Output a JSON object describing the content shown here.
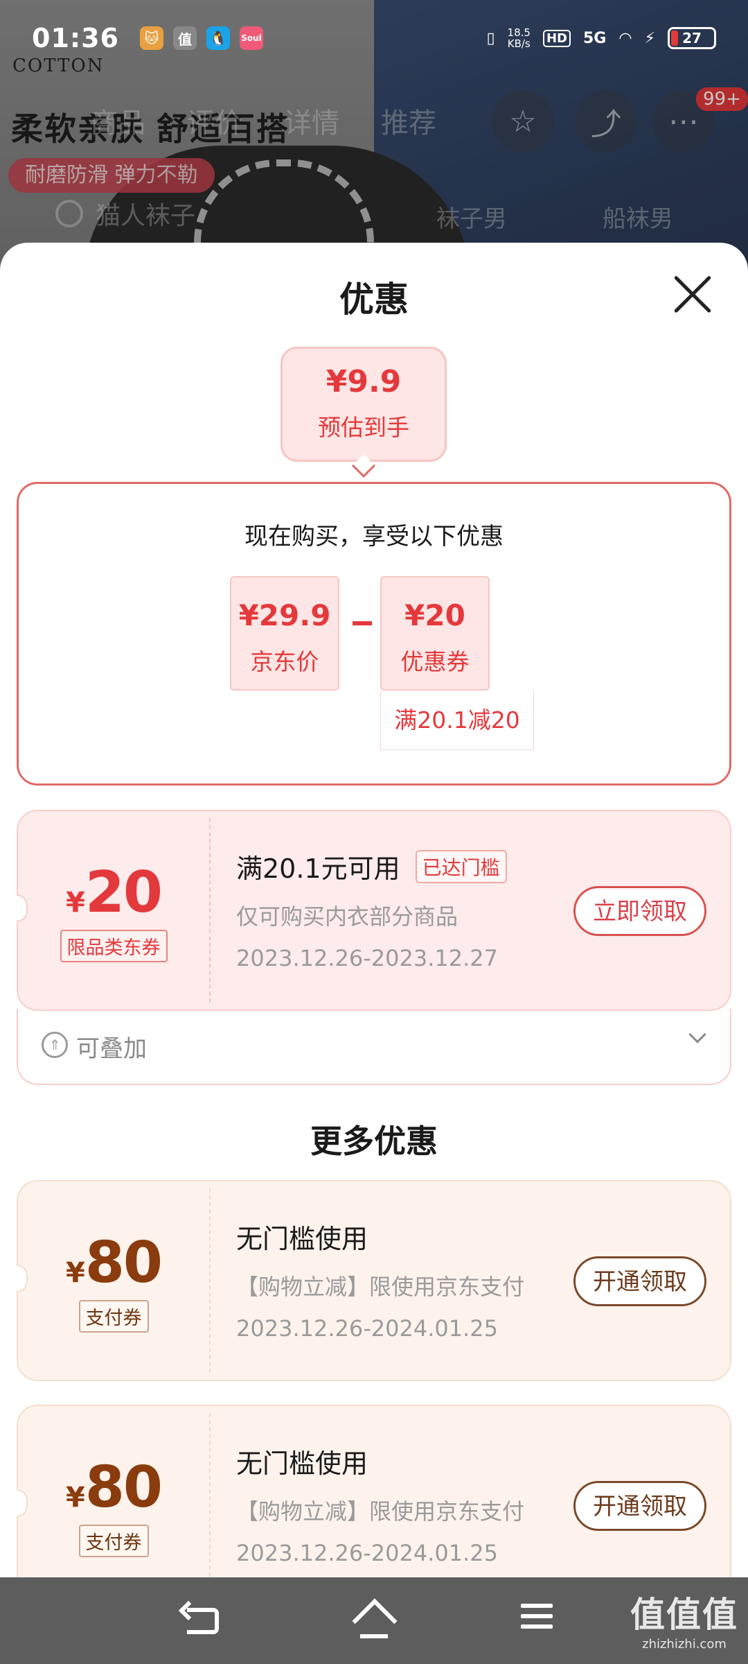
{
  "status_bar": {
    "time": "01:36",
    "net_speed_value": "18.5",
    "net_speed_unit": "KB/s",
    "hd": "HD",
    "signal": "5G",
    "battery": "27",
    "apps": [
      {
        "icon": "cat-app-icon",
        "glyph": "🐱",
        "color": "#e8a040"
      },
      {
        "icon": "zhi-app-icon",
        "glyph": "值",
        "color": "#888888"
      },
      {
        "icon": "qq-app-icon",
        "glyph": "🐧",
        "color": "#1aa3e8"
      },
      {
        "icon": "soul-app-icon",
        "glyph": "Soul",
        "color": "#f05a78"
      }
    ]
  },
  "background": {
    "brand": "COTTON",
    "tagline": "柔软亲肤 舒适百搭",
    "pill": "耐磨防滑 弹力不勒",
    "tabs": [
      "商品",
      "评价",
      "详情",
      "推荐"
    ],
    "search_placeholder": "猫人袜子",
    "keywords": [
      "袜子男",
      "船袜男"
    ],
    "badge": "99+"
  },
  "sheet": {
    "title": "优惠",
    "close_icon": "close-icon",
    "estimate": {
      "price": "¥9.9",
      "label": "预估到手"
    },
    "breakdown": {
      "heading": "现在购买，享受以下优惠",
      "jd_price": {
        "value": "¥29.9",
        "label": "京东价"
      },
      "operator": "-",
      "coupon": {
        "value": "¥20",
        "label": "优惠券",
        "condition": "满20.1减20"
      }
    },
    "main_coupon": {
      "symbol": "¥",
      "amount": "20",
      "tag": "限品类东券",
      "title": "满20.1元可用",
      "status_tag": "已达门槛",
      "desc": "仅可购买内衣部分商品",
      "date": "2023.12.26-2023.12.27",
      "button": "立即领取",
      "stack_label": "可叠加"
    },
    "more_title": "更多优惠",
    "more_coupons": [
      {
        "symbol": "¥",
        "amount": "80",
        "tag": "支付券",
        "title": "无门槛使用",
        "desc": "【购物立减】限使用京东支付",
        "date": "2023.12.26-2024.01.25",
        "button": "开通领取"
      },
      {
        "symbol": "¥",
        "amount": "80",
        "tag": "支付券",
        "title": "无门槛使用",
        "desc": "【购物立减】限使用京东支付",
        "date": "2023.12.26-2024.01.25",
        "button": "开通领取"
      }
    ]
  },
  "watermark": {
    "big": "值值值",
    "small": "zhizhizhi.com"
  },
  "colors": {
    "accent_red": "#e4393c",
    "coupon_brown": "#8a3c0e",
    "nav_bg": "#5d5d5d"
  }
}
